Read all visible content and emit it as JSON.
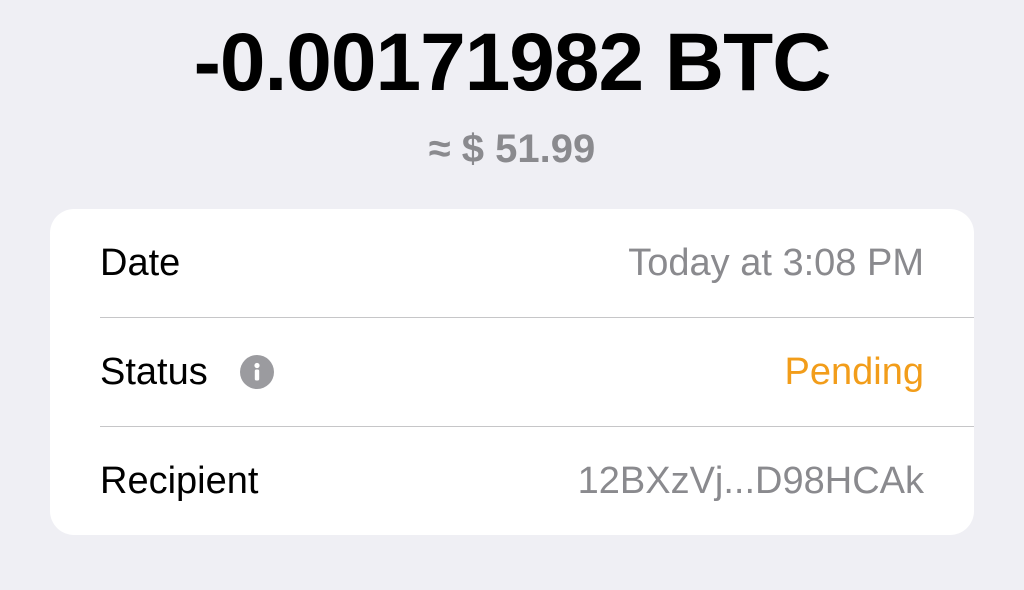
{
  "transaction": {
    "amount": "-0.00171982 BTC",
    "fiat_equivalent": "≈ $ 51.99"
  },
  "details": {
    "date": {
      "label": "Date",
      "value": "Today at 3:08 PM"
    },
    "status": {
      "label": "Status",
      "value": "Pending",
      "icon": "info-icon"
    },
    "recipient": {
      "label": "Recipient",
      "value": "12BXzVj...D98HCAk"
    }
  },
  "colors": {
    "background": "#efeff4",
    "card": "#ffffff",
    "primary_text": "#000000",
    "secondary_text": "#8a8a8e",
    "pending": "#f29d1a",
    "divider": "#c6c6c8"
  }
}
